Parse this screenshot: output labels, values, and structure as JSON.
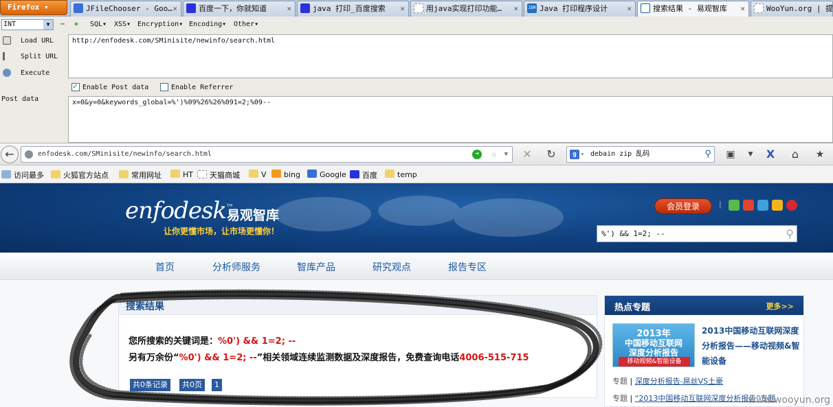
{
  "browser": {
    "firefox_button": "Firefox ▾",
    "tabs": [
      {
        "title": "JFileChooser - Goo…",
        "icon_color": "#3b6fd6"
      },
      {
        "title": "百度一下，你就知道",
        "icon_color": "#2932e1"
      },
      {
        "title": "java 打印_百度搜索",
        "icon_color": "#2932e1"
      },
      {
        "title": "用java实现打印功能…",
        "icon_color": "#cccccc"
      },
      {
        "title": "Java 打印程序设计",
        "icon_color": "#1f70c1"
      },
      {
        "title": "搜索结果 - 易观智库",
        "icon_color": "#1e5aa0"
      },
      {
        "title": "WooYun.org | 提交",
        "icon_color": "#cccccc"
      }
    ],
    "close_glyph": "×"
  },
  "hackbar": {
    "type_select": "INT",
    "menus": [
      "SQL▾",
      "XSS▾",
      "Encryption▾",
      "Encoding▾",
      "Other▾"
    ],
    "actions": {
      "load": "Load URL",
      "split": "Split URL",
      "execute": "Execute"
    },
    "url_value": "http://enfodesk.com/SMinisite/newinfo/search.html",
    "enable_post": "Enable Post data",
    "enable_referrer": "Enable Referrer",
    "post_label": "Post data",
    "post_value": "x=0&y=0&keywords_global=%')%09%26%26%091=2;%09--"
  },
  "navbar": {
    "url": "enfodesk.com/SMinisite/newinfo/search.html",
    "search_value": "debain zip 乱码"
  },
  "bookmarks": [
    {
      "label": "访问最多",
      "icon": "folder-icon"
    },
    {
      "label": "火狐官方站点",
      "icon": "folder-icon"
    },
    {
      "label": "常用网址",
      "icon": "folder-icon"
    },
    {
      "label": "HT",
      "icon": "folder-icon"
    },
    {
      "label": "天猫商城",
      "icon": "page-icon"
    },
    {
      "label": "V",
      "icon": "folder-icon"
    },
    {
      "label": "bing",
      "icon": "bing-icon"
    },
    {
      "label": "Google",
      "icon": "google-icon"
    },
    {
      "label": "百度",
      "icon": "baidu-icon"
    },
    {
      "label": "temp",
      "icon": "folder-icon"
    }
  ],
  "site": {
    "logo": "enfodesk",
    "logo_tm": "™",
    "logo_cn": "易观智库",
    "slogan": "让你更懂市场，让市场更懂你！",
    "login": "会员登录",
    "search_value": "%')  &&   1=2; --",
    "nav": [
      "首页",
      "分析师服务",
      "智库产品",
      "研究观点",
      "报告专区"
    ],
    "results": {
      "title": "搜索结果",
      "line1_prefix": "您所搜索的关键词是：",
      "line1_keyword": "%0') && 1=2; --",
      "line2_prefix": "另有万余份“",
      "line2_keyword": "%0') && 1=2; --",
      "line2_suffix": "”相关领域连续监测数据及深度报告，免费查询电话",
      "line2_phone": "4006-515-715",
      "pager": [
        "共0条记录",
        "共0页",
        "1"
      ]
    },
    "hot": {
      "title": "热点专题",
      "more": "更多>>",
      "image_lines": [
        "2013年",
        "中国移动互联网",
        "深度分析报告",
        "移动视频&智能设备"
      ],
      "feature": "2013中国移动互联网深度分析报告——移动视频&智能设备",
      "rows": [
        {
          "label": "专题",
          "link": "深度分析报告-屌丝VS土豪"
        },
        {
          "label": "专题",
          "link": "“2013中国移动互联网深度分析报告”专题"
        }
      ]
    }
  },
  "watermark": "www.wooyun.org",
  "colors": {
    "accent": "#1b4e8c",
    "keyword_red": "#d41515",
    "header_blue": "#0f3f7d"
  }
}
